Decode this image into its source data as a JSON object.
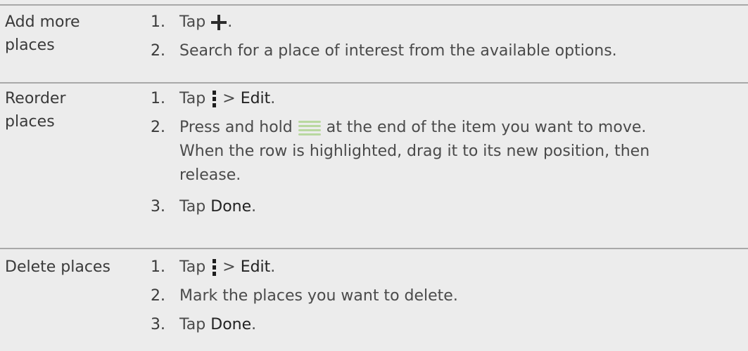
{
  "rows": [
    {
      "label_line1": "Add more",
      "label_line2": "places",
      "steps": [
        {
          "num": "1.",
          "pre": "Tap",
          "icon": "plus-icon",
          "post": "."
        },
        {
          "num": "2.",
          "text": "Search for a place of interest from the available options."
        }
      ]
    },
    {
      "label_line1": "Reorder",
      "label_line2": "places",
      "steps": [
        {
          "num": "1.",
          "pre": "Tap",
          "icon": "menu-icon",
          "mid": ">",
          "action": "Edit",
          "post": "."
        },
        {
          "num": "2.",
          "pre": "Press and hold",
          "icon": "drag-handle-icon",
          "post": "at the end of the item you want to move.",
          "line2": "When the row is highlighted, drag it to its new position, then",
          "line3": "release."
        },
        {
          "num": "3.",
          "pre": "Tap",
          "action": "Done",
          "post": "."
        }
      ]
    },
    {
      "label_line1": "Delete places",
      "steps": [
        {
          "num": "1.",
          "pre": "Tap",
          "icon": "menu-icon",
          "mid": ">",
          "action": "Edit",
          "post": "."
        },
        {
          "num": "2.",
          "text": "Mark the places you want to delete."
        },
        {
          "num": "3.",
          "pre": "Tap",
          "action": "Done",
          "post": "."
        }
      ]
    }
  ]
}
